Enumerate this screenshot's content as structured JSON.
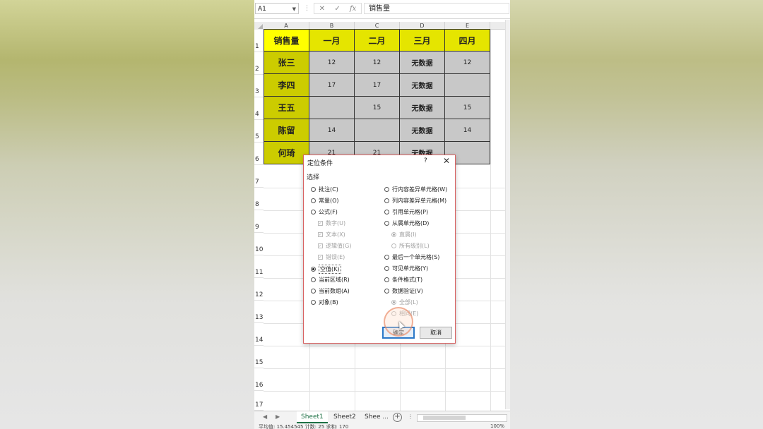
{
  "formula_bar": {
    "name_box": "A1",
    "separator": "⋮",
    "cancel": "✕",
    "enter": "✓",
    "fx": "fx",
    "content": "销售量"
  },
  "columns": [
    "A",
    "B",
    "C",
    "D",
    "E"
  ],
  "rows": [
    "1",
    "2",
    "3",
    "4",
    "5",
    "6",
    "7",
    "8",
    "9",
    "10",
    "11",
    "12",
    "13",
    "14",
    "15",
    "16",
    "17"
  ],
  "table": {
    "header": [
      "销售量",
      "一月",
      "二月",
      "三月",
      "四月"
    ],
    "body": [
      [
        "张三",
        "12",
        "12",
        "无数据",
        "12"
      ],
      [
        "李四",
        "17",
        "17",
        "无数据",
        ""
      ],
      [
        "王五",
        "",
        "15",
        "无数据",
        "15"
      ],
      [
        "陈留",
        "14",
        "",
        "无数据",
        "14"
      ],
      [
        "何琦",
        "21",
        "21",
        "无数据",
        ""
      ]
    ]
  },
  "dialog": {
    "title": "定位条件",
    "help": "?",
    "close": "✕",
    "group_label": "选择",
    "left_options": [
      "批注(C)",
      "常量(O)",
      "公式(F)"
    ],
    "formula_sub": [
      "数字(U)",
      "文本(X)",
      "逻辑值(G)",
      "错误(E)"
    ],
    "left_options2": [
      "空值(K)",
      "当前区域(R)",
      "当前数组(A)",
      "对象(B)"
    ],
    "right_options": [
      "行内容差异单元格(W)",
      "列内容差异单元格(M)",
      "引用单元格(P)",
      "从属单元格(D)"
    ],
    "dependent_sub": [
      "直属(I)",
      "所有级别(L)"
    ],
    "right_options2": [
      "最后一个单元格(S)",
      "可见单元格(Y)",
      "条件格式(T)",
      "数据验证(V)"
    ],
    "validation_sub": [
      "全部(L)",
      "相同(E)"
    ],
    "ok": "确定",
    "cancel": "取消"
  },
  "tabs": {
    "prev": "◀",
    "next": "▶",
    "items": [
      "Sheet1",
      "Sheet2",
      "Shee ..."
    ],
    "add": "+",
    "more": "⋮"
  },
  "status": {
    "text": "平均值: 15.454545  计数: 25  求和: 170",
    "zoom": "100%"
  }
}
